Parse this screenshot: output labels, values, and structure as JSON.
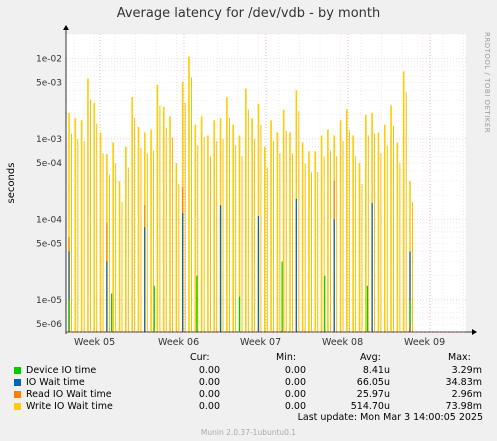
{
  "title": "Average latency for /dev/vdb - by month",
  "side_tag": "RRDTOOL / TOBI OETIKER",
  "footer": "Munin 2.0.37-1ubuntu0.1",
  "last_update": "Last update: Mon Mar  3 14:00:05 2025",
  "legend_headers": {
    "cur": "Cur:",
    "min": "Min:",
    "avg": "Avg:",
    "max": "Max:"
  },
  "legend": [
    {
      "name": "Device IO time",
      "color": "#00cc00",
      "cur": "0.00",
      "min": "0.00",
      "avg": "8.41u",
      "max": "3.29m"
    },
    {
      "name": "IO Wait time",
      "color": "#0066b3",
      "cur": "0.00",
      "min": "0.00",
      "avg": "66.05u",
      "max": "34.83m"
    },
    {
      "name": "Read IO Wait time",
      "color": "#ff8000",
      "cur": "0.00",
      "min": "0.00",
      "avg": "25.97u",
      "max": "2.96m"
    },
    {
      "name": "Write IO Wait time",
      "color": "#ffcc00",
      "cur": "0.00",
      "min": "0.00",
      "avg": "514.70u",
      "max": "73.98m"
    }
  ],
  "chart_data": {
    "type": "line",
    "title": "Average latency for /dev/vdb - by month",
    "ylabel": "seconds",
    "yscale": "log",
    "ylim": [
      4e-06,
      0.02
    ],
    "y_ticks": [
      {
        "value": 5e-06,
        "label": "5e-06"
      },
      {
        "value": 1e-05,
        "label": "1e-05"
      },
      {
        "value": 5e-05,
        "label": "5e-05"
      },
      {
        "value": 0.0001,
        "label": "1e-04"
      },
      {
        "value": 0.0005,
        "label": "5e-04"
      },
      {
        "value": 0.001,
        "label": "1e-03"
      },
      {
        "value": 0.005,
        "label": "5e-03"
      },
      {
        "value": 0.01,
        "label": "1e-02"
      }
    ],
    "x_ticks": [
      "Week 05",
      "Week 06",
      "Week 07",
      "Week 08",
      "Week 09"
    ],
    "grid": true,
    "series": [
      {
        "name": "Write IO Wait time",
        "color": "#ffcc00",
        "values": [
          0.0021,
          0.0018,
          0.0017,
          0.0056,
          0.0028,
          0.0012,
          0.00065,
          0.0009,
          0.0003,
          0.0008,
          0.0033,
          0.0014,
          0.0012,
          0.0013,
          0.0047,
          0.0025,
          0.0019,
          0.0005,
          0.0051,
          0.0105,
          0.0015,
          0.0019,
          0.0011,
          0.0017,
          0.0018,
          0.0033,
          0.0015,
          0.0011,
          0.0042,
          0.0018,
          0.0027,
          0.0008,
          0.0017,
          0.0012,
          0.0023,
          0.0012,
          0.004,
          0.0009,
          0.0007,
          0.0007,
          0.0011,
          0.0013,
          0.0011,
          0.0017,
          0.0023,
          0.0011,
          0.0005,
          0.002,
          0.0021,
          0.0012,
          0.0015,
          0.0026,
          0.0009,
          0.0069,
          0.0003
        ]
      },
      {
        "name": "IO Wait time",
        "color": "#0066b3",
        "values": [
          4e-05,
          3e-05,
          8e-05,
          0.00012,
          0.00015,
          0.00011,
          0.00018,
          0.0001,
          0.00016,
          4e-05
        ]
      },
      {
        "name": "Read IO Wait time",
        "color": "#ff8000",
        "values": [
          6e-05,
          9e-05,
          0.00015,
          0.00025,
          0.00012,
          8e-05,
          0.00014,
          0.0003,
          6e-05,
          3e-05
        ]
      },
      {
        "name": "Device IO time",
        "color": "#00cc00",
        "values": [
          1e-05,
          1.2e-05,
          1.5e-05,
          2e-05,
          1.1e-05,
          3e-05,
          2e-05,
          1.5e-05,
          1e-05
        ]
      }
    ]
  }
}
